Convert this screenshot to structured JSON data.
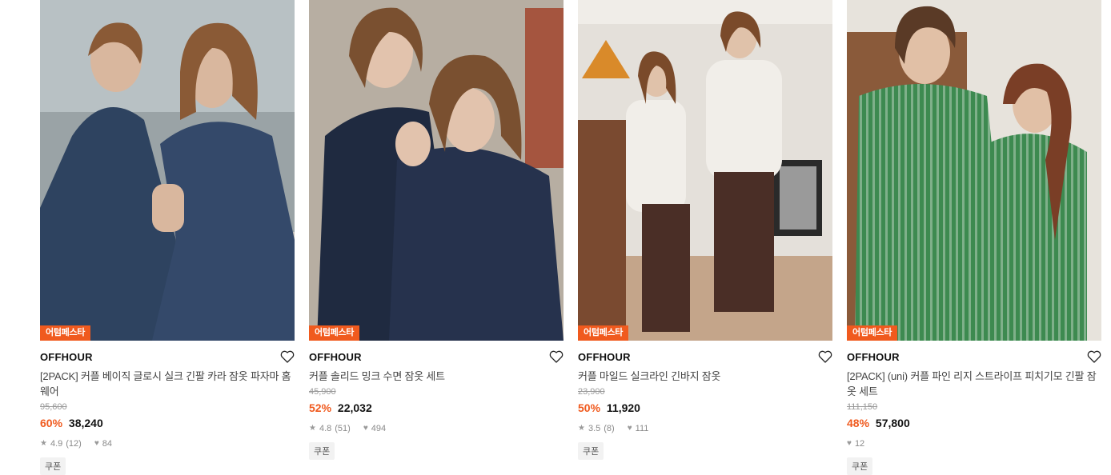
{
  "products": [
    {
      "badge": "어텀페스타",
      "brand": "OFFHOUR",
      "title": "[2PACK] 커플 베이직 글로시 실크 긴팔 카라 잠옷 파자마 홈웨어",
      "original_price": "95,600",
      "discount": "60%",
      "price": "38,240",
      "rating": "4.9",
      "reviews": "(12)",
      "likes": "84",
      "coupon": "쿠폰",
      "image_palette": {
        "bg": "#9aa3a6",
        "a": "#2e4360",
        "b": "#34496a",
        "skin": "#d9b79e",
        "hair": "#8a5a36"
      }
    },
    {
      "badge": "어텀페스타",
      "brand": "OFFHOUR",
      "title": "커플 솔리드 밍크 수면 잠옷 세트",
      "original_price": "45,900",
      "discount": "52%",
      "price": "22,032",
      "rating": "4.8",
      "reviews": "(51)",
      "likes": "494",
      "coupon": "쿠폰",
      "image_palette": {
        "bg": "#b7aea2",
        "a": "#1f2a40",
        "b": "#26324d",
        "skin": "#e2c3ad",
        "hair": "#7a5030"
      }
    },
    {
      "badge": "어텀페스타",
      "brand": "OFFHOUR",
      "title": "커플 마일드 실크라인 긴바지 잠옷",
      "original_price": "23,900",
      "discount": "50%",
      "price": "11,920",
      "rating": "3.5",
      "reviews": "(8)",
      "likes": "111",
      "coupon": "쿠폰",
      "image_palette": {
        "bg": "#e4e0da",
        "a": "#f1eee9",
        "b": "#4a2e26",
        "skin": "#e0c2aa",
        "hair": "#7a4a2a"
      }
    },
    {
      "badge": "어텀페스타",
      "brand": "OFFHOUR",
      "title": "[2PACK] (uni) 커플 파인 리지 스트라이프 피치기모 긴팔 잠옷 세트",
      "original_price": "111,150",
      "discount": "48%",
      "price": "57,800",
      "likes": "12",
      "coupon": "쿠폰",
      "image_palette": {
        "bg": "#e7e3dc",
        "a": "#3d8a50",
        "b": "#2f7a44",
        "skin": "#e1c0a6",
        "hair": "#7a3e26"
      }
    }
  ]
}
